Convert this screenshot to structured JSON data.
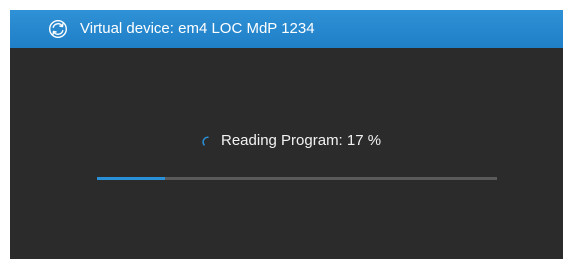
{
  "window": {
    "title": "Virtual device: em4 LOC MdP 1234",
    "icon": "refresh-sync-icon",
    "accent_color": "#2f91d6",
    "background_color": "#2b2b2b"
  },
  "status": {
    "label": "Reading Program: 17 %",
    "spinner_icon": "loading-spinner-icon"
  },
  "progress": {
    "fraction": 0.17,
    "fill_color": "#2a90d8",
    "track_color": "#5a5a5a"
  }
}
